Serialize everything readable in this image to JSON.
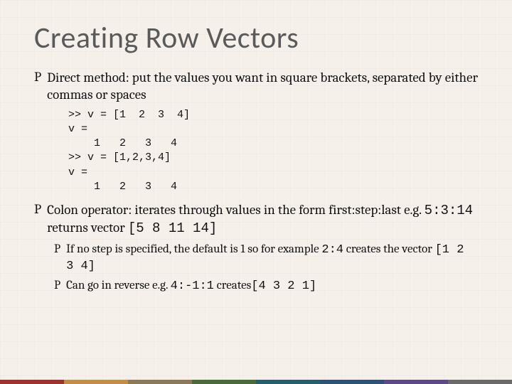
{
  "title": "Creating Row Vectors",
  "bullets": [
    {
      "text": "Direct method: put the values you want in square brackets, separated by either commas or spaces",
      "code": ">> v = [1  2  3  4]\nv =\n    1   2   3   4\n>> v = [1,2,3,4]\nv =\n    1   2   3   4"
    },
    {
      "text_parts": [
        "Colon operator:  iterates through values in the form first:step:last e.g. ",
        "5:3:14",
        "  returns vector ",
        "[5 8 11 14]"
      ],
      "subs": [
        {
          "parts": [
            "If no step is specified, the default is 1 so for example ",
            "2:4",
            "  creates the vector ",
            "[1 2 3 4]"
          ]
        },
        {
          "parts": [
            "Can go in reverse e.g. ",
            "4:-1:1",
            "  creates",
            "[4 3 2 1]"
          ]
        }
      ]
    }
  ],
  "bullet_glyph": "P"
}
